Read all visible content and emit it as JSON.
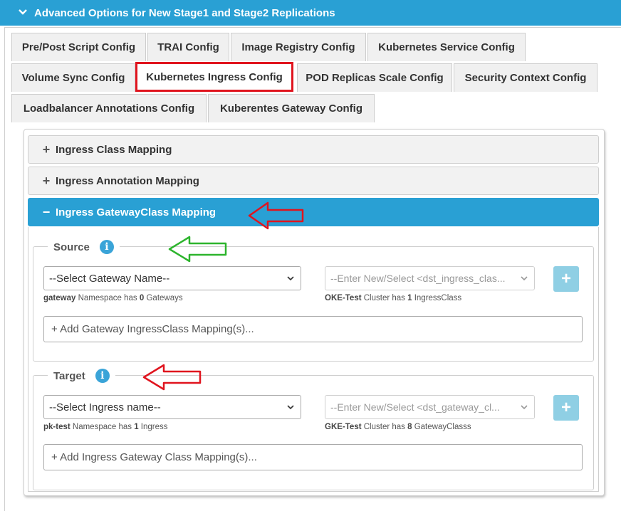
{
  "header": {
    "title": "Advanced Options for New Stage1 and Stage2 Replications"
  },
  "tabs": [
    {
      "label": "Pre/Post Script Config"
    },
    {
      "label": "TRAI Config"
    },
    {
      "label": "Image Registry Config"
    },
    {
      "label": "Kubernetes Service Config"
    },
    {
      "label": "Volume Sync Config"
    },
    {
      "label": "Kubernetes Ingress Config"
    },
    {
      "label": "POD Replicas Scale Config"
    },
    {
      "label": "Security Context Config"
    },
    {
      "label": "Loadbalancer Annotations Config"
    },
    {
      "label": "Kuberentes Gateway Config"
    }
  ],
  "active_tab": "Kubernetes Ingress Config",
  "accordion": [
    {
      "label": "Ingress Class Mapping",
      "sign": "+"
    },
    {
      "label": "Ingress Annotation Mapping",
      "sign": "+"
    },
    {
      "label": "Ingress GatewayClass Mapping",
      "sign": "−"
    }
  ],
  "source": {
    "legend": "Source",
    "select_left": "--Select Gateway Name--",
    "select_right": "--Enter New/Select <dst_ingress_clas...",
    "note_left": {
      "bold": "gateway",
      "mid": " Namespace has ",
      "count": "0",
      "tail": " Gateways"
    },
    "note_right": {
      "bold": "OKE-Test",
      "mid": " Cluster has ",
      "count": "1",
      "tail": " IngressClass"
    },
    "add_placeholder": "+ Add Gateway IngressClass Mapping(s)..."
  },
  "target": {
    "legend": "Target",
    "select_left": "--Select Ingress name--",
    "select_right": "--Enter New/Select <dst_gateway_cl...",
    "note_left": {
      "bold": "pk-test",
      "mid": " Namespace has ",
      "count": "1",
      "tail": " Ingress"
    },
    "note_right": {
      "bold": "GKE-Test",
      "mid": " Cluster has ",
      "count": "8",
      "tail": " GatewayClasss"
    },
    "add_placeholder": "+ Add Ingress Gateway Class Mapping(s)..."
  },
  "plus_label": "+",
  "info_label": "i",
  "colors": {
    "accent": "#29a0d4",
    "annotation_red": "#e0141e",
    "annotation_green": "#2db42d"
  }
}
